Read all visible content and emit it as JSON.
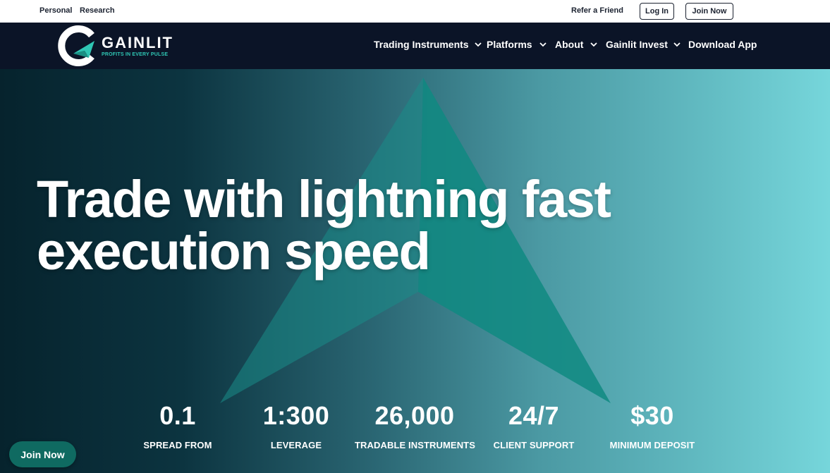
{
  "topbar": {
    "personal": "Personal",
    "research": "Research",
    "refer": "Refer a Friend",
    "login": "Log In",
    "join": "Join Now"
  },
  "brand": {
    "name": "GAINLIT",
    "tagline": "PROFITS IN EVERY PULSE",
    "accent_color": "#2fc6b4"
  },
  "nav": {
    "items": [
      {
        "label": "Trading Instruments",
        "icon": "chevron-down-icon"
      },
      {
        "label": "Platforms",
        "icon": "chevron-down-icon"
      },
      {
        "label": "About",
        "icon": "chevron-down-icon"
      },
      {
        "label": "Gainlit Invest",
        "icon": "chevron-down-icon"
      },
      {
        "label": "Download App"
      }
    ]
  },
  "hero": {
    "title": "Trade with lightning fast execution speed",
    "stats": [
      {
        "value": "0.1",
        "label": "SPREAD FROM"
      },
      {
        "value": "1:300",
        "label": "LEVERAGE"
      },
      {
        "value": "26,000",
        "label": "TRADABLE INSTRUMENTS"
      },
      {
        "value": "24/7",
        "label": "CLIENT SUPPORT"
      },
      {
        "value": "$30",
        "label": "MINIMUM DEPOSIT"
      }
    ]
  },
  "floating_cta": {
    "label": "Join Now",
    "color": "#0f6a61"
  }
}
